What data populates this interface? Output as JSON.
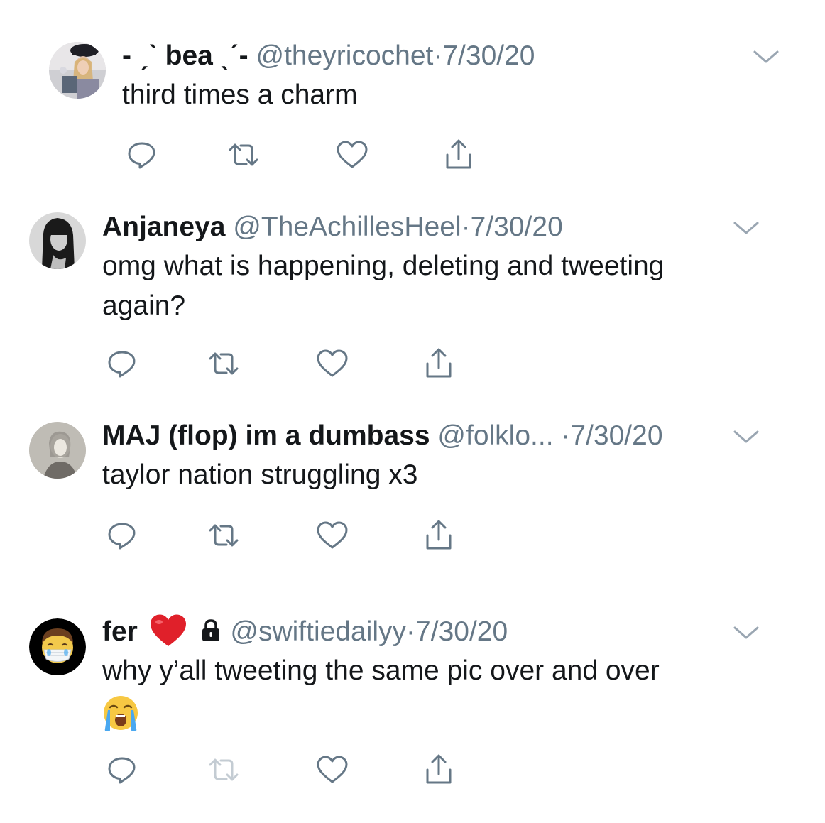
{
  "colors": {
    "text": "#14171a",
    "muted": "#657786",
    "icon": "#657786",
    "icon_disabled": "#c4ccd3",
    "heart": "#e0202a"
  },
  "tweets": [
    {
      "name": "- ˏˋ bea ˎˊ-",
      "handle": "@theyricochet",
      "dot": "·",
      "date": "7/30/20",
      "text": [
        "third times a charm"
      ],
      "avatar_icon": "avatar-photo-icon"
    },
    {
      "name": "Anjaneya",
      "handle": "@TheAchillesHeel",
      "dot": "·",
      "date": "7/30/20",
      "text": [
        "omg what is happening, deleting and tweeting",
        "again?"
      ],
      "avatar_icon": "avatar-photo-icon"
    },
    {
      "name": "MAJ (flop) im a dumbass",
      "handle": "@folklo...",
      "dot": "·",
      "date": "7/30/20",
      "text": [
        "taylor nation struggling x3"
      ],
      "avatar_icon": "avatar-photo-icon"
    },
    {
      "name": "fer",
      "handle": "@swiftiedailyy",
      "dot": "·",
      "date": "7/30/20",
      "text": [
        "why y’all tweeting the same pic over and over"
      ],
      "name_icons": [
        "red-heart-icon",
        "lock-icon"
      ],
      "trailing_emoji": "crying-face-icon",
      "avatar_icon": "mask-face-emoji-icon",
      "retweet_disabled": true
    }
  ],
  "actions": [
    "reply-icon",
    "retweet-icon",
    "like-icon",
    "share-icon"
  ]
}
